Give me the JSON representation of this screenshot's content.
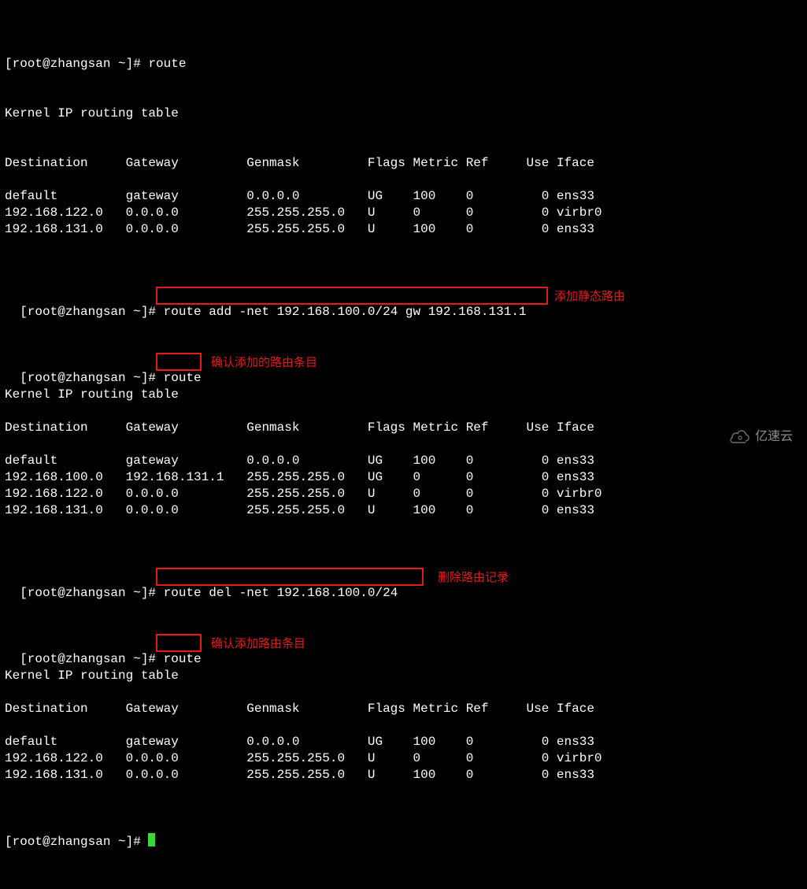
{
  "prompt_prefix": "[root@zhangsan ~]# ",
  "host": "zhangsan",
  "user": "root",
  "commands": {
    "route1": "route",
    "route_add": "route add -net 192.168.100.0/24 gw 192.168.131.1",
    "route2": "route",
    "route_del": "route del -net 192.168.100.0/24",
    "route3": "route"
  },
  "annotations": {
    "add_static": "添加静态路由",
    "confirm_added": "确认添加的路由条目",
    "del_record": "删除路由记录",
    "confirm_after_del": "确认添加路由条目"
  },
  "table_title": "Kernel IP routing table",
  "headers": {
    "dest": "Destination",
    "gw": "Gateway",
    "mask": "Genmask",
    "flags": "Flags",
    "metric": "Metric",
    "ref": "Ref",
    "use": "Use",
    "iface": "Iface"
  },
  "tables": {
    "initial": [
      {
        "dest": "default",
        "gw": "gateway",
        "mask": "0.0.0.0",
        "flags": "UG",
        "metric": "100",
        "ref": "0",
        "use": "0",
        "iface": "ens33"
      },
      {
        "dest": "192.168.122.0",
        "gw": "0.0.0.0",
        "mask": "255.255.255.0",
        "flags": "U",
        "metric": "0",
        "ref": "0",
        "use": "0",
        "iface": "virbr0"
      },
      {
        "dest": "192.168.131.0",
        "gw": "0.0.0.0",
        "mask": "255.255.255.0",
        "flags": "U",
        "metric": "100",
        "ref": "0",
        "use": "0",
        "iface": "ens33"
      }
    ],
    "after_add": [
      {
        "dest": "default",
        "gw": "gateway",
        "mask": "0.0.0.0",
        "flags": "UG",
        "metric": "100",
        "ref": "0",
        "use": "0",
        "iface": "ens33"
      },
      {
        "dest": "192.168.100.0",
        "gw": "192.168.131.1",
        "mask": "255.255.255.0",
        "flags": "UG",
        "metric": "0",
        "ref": "0",
        "use": "0",
        "iface": "ens33"
      },
      {
        "dest": "192.168.122.0",
        "gw": "0.0.0.0",
        "mask": "255.255.255.0",
        "flags": "U",
        "metric": "0",
        "ref": "0",
        "use": "0",
        "iface": "virbr0"
      },
      {
        "dest": "192.168.131.0",
        "gw": "0.0.0.0",
        "mask": "255.255.255.0",
        "flags": "U",
        "metric": "100",
        "ref": "0",
        "use": "0",
        "iface": "ens33"
      }
    ],
    "after_del": [
      {
        "dest": "default",
        "gw": "gateway",
        "mask": "0.0.0.0",
        "flags": "UG",
        "metric": "100",
        "ref": "0",
        "use": "0",
        "iface": "ens33"
      },
      {
        "dest": "192.168.122.0",
        "gw": "0.0.0.0",
        "mask": "255.255.255.0",
        "flags": "U",
        "metric": "0",
        "ref": "0",
        "use": "0",
        "iface": "virbr0"
      },
      {
        "dest": "192.168.131.0",
        "gw": "0.0.0.0",
        "mask": "255.255.255.0",
        "flags": "U",
        "metric": "100",
        "ref": "0",
        "use": "0",
        "iface": "ens33"
      }
    ]
  },
  "watermark": "亿速云"
}
